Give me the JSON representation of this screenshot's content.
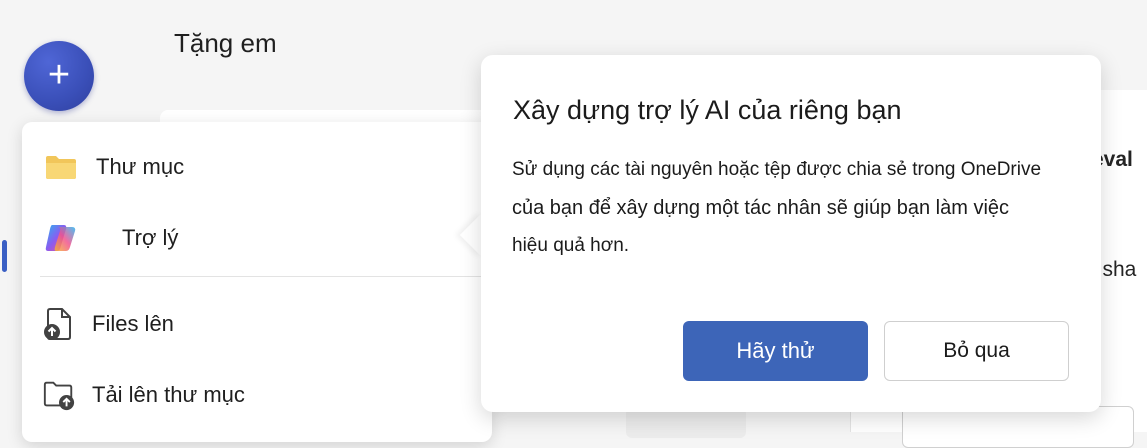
{
  "header": {
    "title": "Tặng em"
  },
  "add_button": {
    "icon": "plus-icon",
    "color": "#3a4fb8"
  },
  "menu": {
    "items": [
      {
        "label": "Thư mục",
        "icon": "folder-icon"
      },
      {
        "label": "Trợ lý",
        "icon": "copilot-icon"
      },
      {
        "label": "Files lên",
        "icon": "file-upload-icon"
      },
      {
        "label": "Tải lên thư mục",
        "icon": "folder-upload-icon"
      }
    ]
  },
  "popover": {
    "title": "Xây dựng trợ lý AI của riêng bạn",
    "body_line1": "Sử dụng các tài nguyên hoặc tệp được chia sẻ trong OneDrive",
    "body_line2": "của bạn để xây dựng một tác nhân sẽ giúp bạn làm việc",
    "body_line3": "hiệu quả hơn.",
    "primary_button": "Hãy thử",
    "secondary_button": "Bỏ qua",
    "primary_color": "#3d65b8"
  },
  "background_peek": {
    "text1": "eval",
    "text2": "l sha"
  }
}
